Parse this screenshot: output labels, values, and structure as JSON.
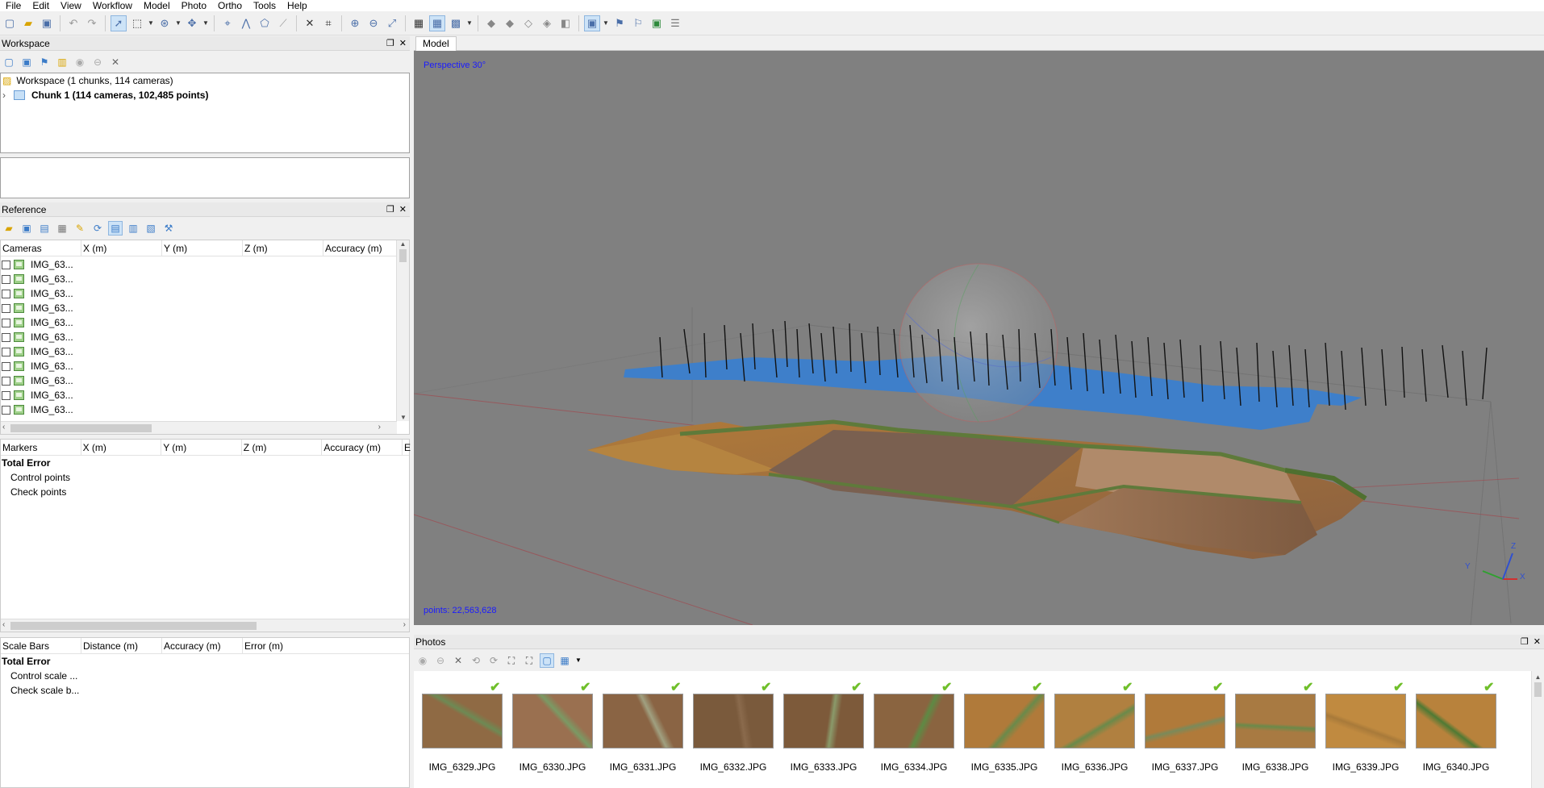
{
  "menu": [
    "File",
    "Edit",
    "View",
    "Workflow",
    "Model",
    "Photo",
    "Ortho",
    "Tools",
    "Help"
  ],
  "toolbar_icons": [
    "new-icon",
    "open-icon",
    "save-icon",
    "undo-icon",
    "redo-icon",
    "select-icon",
    "rect-select-icon",
    "dropdown-icon",
    "navigate-icon",
    "dropdown-icon",
    "move-icon",
    "dropdown-icon",
    "point-icon",
    "ruler-icon",
    "polygon-icon",
    "measure-icon",
    "cut-icon",
    "crop-icon",
    "zoom-in-icon",
    "zoom-out-icon",
    "fit-icon",
    "grid-icon",
    "grid-active-icon",
    "view-mode-icon",
    "dropdown-icon",
    "shape-icon",
    "shape-icon",
    "shape-icon",
    "shape-icon",
    "shape-icon",
    "camera-icon",
    "dropdown-icon",
    "markers-icon",
    "flag-icon",
    "ortho-icon",
    "layers-icon"
  ],
  "workspace": {
    "title": "Workspace",
    "root": "Workspace (1 chunks, 114 cameras)",
    "chunk": "Chunk 1 (114 cameras, 102,485 points)"
  },
  "reference": {
    "title": "Reference",
    "cameras_headers": [
      "Cameras",
      "X (m)",
      "Y (m)",
      "Z (m)",
      "Accuracy (m)"
    ],
    "cameras": [
      "IMG_63...",
      "IMG_63...",
      "IMG_63...",
      "IMG_63...",
      "IMG_63...",
      "IMG_63...",
      "IMG_63...",
      "IMG_63...",
      "IMG_63...",
      "IMG_63...",
      "IMG_63..."
    ],
    "markers_headers": [
      "Markers",
      "X (m)",
      "Y (m)",
      "Z (m)",
      "Accuracy (m)",
      "E"
    ],
    "markers_total": "Total Error",
    "markers_rows": [
      "Control points",
      "Check points"
    ],
    "scalebars_headers": [
      "Scale Bars",
      "Distance (m)",
      "Accuracy (m)",
      "Error (m)"
    ],
    "scalebars_total": "Total Error",
    "scalebars_rows": [
      "Control scale ...",
      "Check scale b..."
    ]
  },
  "model": {
    "tab": "Model",
    "perspective": "Perspective 30°",
    "points": "points: 22,563,628",
    "axes": {
      "x": "X",
      "y": "Y",
      "z": "Z"
    }
  },
  "photos": {
    "title": "Photos",
    "items": [
      "IMG_6329.JPG",
      "IMG_6330.JPG",
      "IMG_6331.JPG",
      "IMG_6332.JPG",
      "IMG_6333.JPG",
      "IMG_6334.JPG",
      "IMG_6335.JPG",
      "IMG_6336.JPG",
      "IMG_6337.JPG",
      "IMG_6338.JPG",
      "IMG_6339.JPG",
      "IMG_6340.JPG"
    ]
  },
  "colors": {
    "accent": "#3c7cc8",
    "viewport": "#808080",
    "check": "#6fbf2a",
    "label_blue": "#0000ff"
  }
}
